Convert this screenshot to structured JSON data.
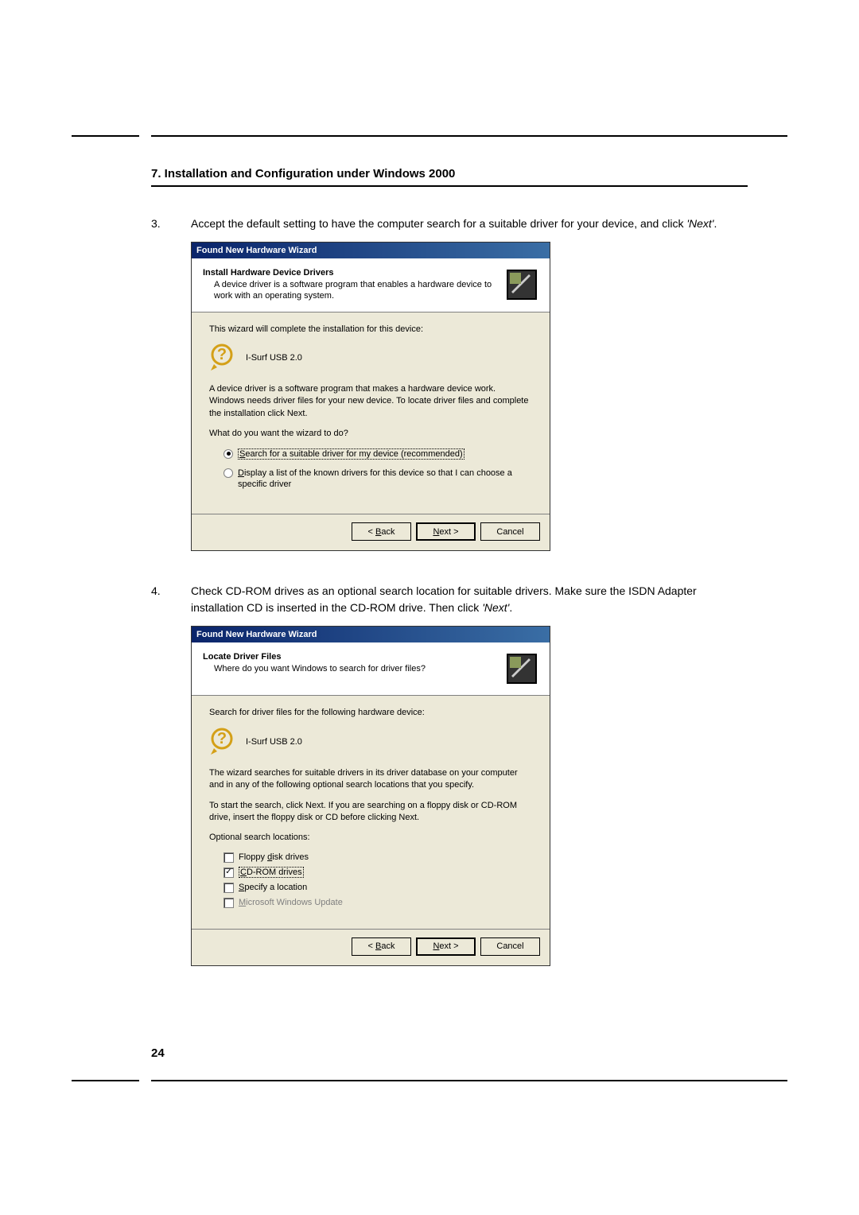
{
  "section_heading": "7. Installation and Configuration under Windows 2000",
  "instructions": {
    "step3": {
      "num": "3.",
      "text_a": "Accept the default setting to have the computer search for a suitable driver for your device, and click ",
      "text_b": "'Next'",
      "text_c": "."
    },
    "step4": {
      "num": "4.",
      "text_a": "Check CD-ROM drives as an optional search location for suitable drivers. Make sure the ISDN Adapter installation CD is inserted in the CD-ROM drive. Then click ",
      "text_b": "'Next'",
      "text_c": "."
    }
  },
  "dialog1": {
    "title": "Found New Hardware Wizard",
    "header_title": "Install Hardware Device Drivers",
    "header_sub": "A device driver is a software program that enables a hardware device to work with an operating system.",
    "body_l1": "This wizard will complete the installation for this device:",
    "device_name": "I-Surf USB 2.0",
    "body_l2": "A device driver is a software program that makes a hardware device work. Windows needs driver files for your new device. To locate driver files and complete the installation click Next.",
    "prompt": "What do you want the wizard to do?",
    "radio1_pre": "S",
    "radio1_rest": "earch for a suitable driver for my device (recommended)",
    "radio2_pre": "D",
    "radio2_rest": "isplay a list of the known drivers for this device so that I can choose a specific driver",
    "btn_back_pre": "< ",
    "btn_back_u": "B",
    "btn_back_rest": "ack",
    "btn_next_u": "N",
    "btn_next_rest": "ext >",
    "btn_cancel": "Cancel"
  },
  "dialog2": {
    "title": "Found New Hardware Wizard",
    "header_title": "Locate Driver Files",
    "header_sub": "Where do you want Windows to search for driver files?",
    "body_l1": "Search for driver files for the following hardware device:",
    "device_name": "I-Surf USB 2.0",
    "body_l2": "The wizard searches for suitable drivers in its driver database on your computer and in any of the following optional search locations that you specify.",
    "body_l3": "To start the search, click Next. If you are searching on a floppy disk or CD-ROM drive, insert the floppy disk or CD before clicking Next.",
    "opt_heading": "Optional search locations:",
    "opt1_pre": "Floppy ",
    "opt1_u": "d",
    "opt1_rest": "isk drives",
    "opt2_u": "C",
    "opt2_rest": "D-ROM drives",
    "opt3_u": "S",
    "opt3_rest": "pecify a location",
    "opt4_u": "M",
    "opt4_rest": "icrosoft Windows Update",
    "btn_back_pre": "< ",
    "btn_back_u": "B",
    "btn_back_rest": "ack",
    "btn_next_u": "N",
    "btn_next_rest": "ext >",
    "btn_cancel": "Cancel"
  },
  "page_number": "24"
}
